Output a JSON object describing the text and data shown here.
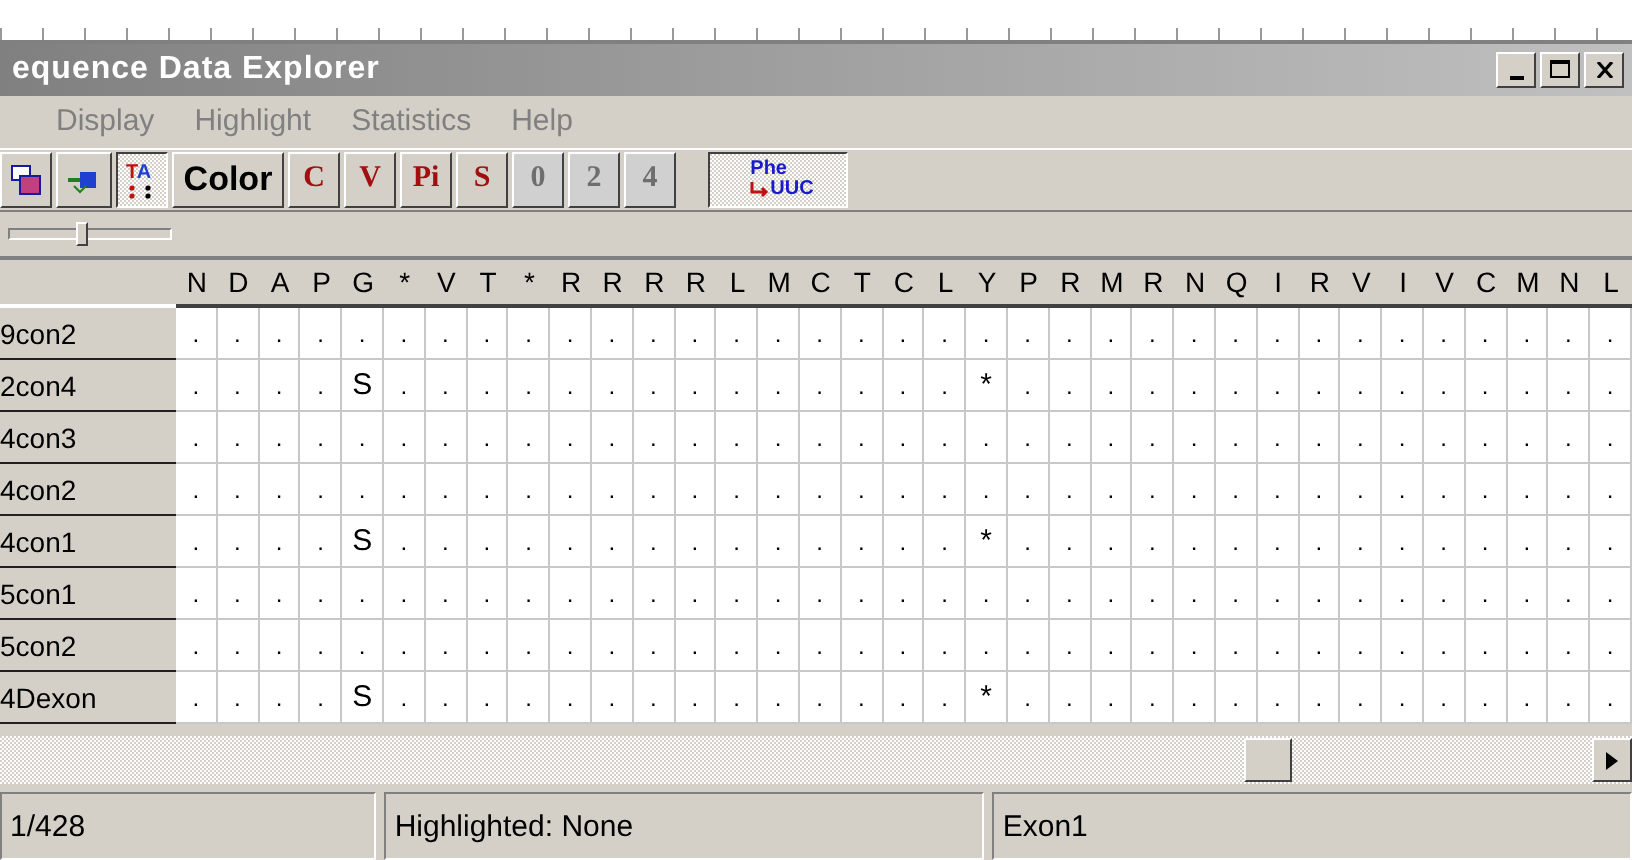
{
  "window": {
    "title": "equence Data Explorer"
  },
  "menu": [
    {
      "label": "Display"
    },
    {
      "label": "Highlight"
    },
    {
      "label": "Statistics"
    },
    {
      "label": "Help"
    }
  ],
  "toolbar": [
    {
      "kind": "icon",
      "pressed": false,
      "disabled": false
    },
    {
      "kind": "icon",
      "pressed": false,
      "disabled": false
    },
    {
      "kind": "letters",
      "label": "TA",
      "pressed": true,
      "disabled": false
    },
    {
      "kind": "text",
      "label": "Color",
      "pressed": false,
      "disabled": false
    },
    {
      "kind": "code",
      "label": "C",
      "pressed": false,
      "disabled": false
    },
    {
      "kind": "code",
      "label": "V",
      "pressed": false,
      "disabled": false
    },
    {
      "kind": "code",
      "label": "Pi",
      "pressed": false,
      "disabled": false
    },
    {
      "kind": "code",
      "label": "S",
      "pressed": false,
      "disabled": false
    },
    {
      "kind": "code",
      "label": "0",
      "pressed": false,
      "disabled": true
    },
    {
      "kind": "code",
      "label": "2",
      "pressed": false,
      "disabled": true
    },
    {
      "kind": "code",
      "label": "4",
      "pressed": false,
      "disabled": true
    },
    {
      "kind": "translate",
      "label": "Phe",
      "label2": "UUC",
      "pressed": true,
      "disabled": false
    }
  ],
  "slider": {
    "level": 0.45
  },
  "grid": {
    "columns": [
      "N",
      "D",
      "A",
      "P",
      "G",
      "*",
      "V",
      "T",
      "*",
      "R",
      "R",
      "R",
      "R",
      "L",
      "M",
      "C",
      "T",
      "C",
      "L",
      "Y",
      "P",
      "R",
      "M",
      "R",
      "N",
      "Q",
      "I",
      "R",
      "V",
      "I",
      "V",
      "C",
      "M",
      "N",
      "L"
    ],
    "rows": [
      {
        "name": "9con2",
        "cells": [
          ".",
          ".",
          ".",
          ".",
          ".",
          ".",
          ".",
          ".",
          ".",
          ".",
          ".",
          ".",
          ".",
          ".",
          ".",
          ".",
          ".",
          ".",
          ".",
          ".",
          ".",
          ".",
          ".",
          ".",
          ".",
          ".",
          ".",
          ".",
          ".",
          ".",
          ".",
          ".",
          ".",
          ".",
          "."
        ]
      },
      {
        "name": "2con4",
        "cells": [
          ".",
          ".",
          ".",
          ".",
          "S",
          ".",
          ".",
          ".",
          ".",
          ".",
          ".",
          ".",
          ".",
          ".",
          ".",
          ".",
          ".",
          ".",
          ".",
          "*",
          ".",
          ".",
          ".",
          ".",
          ".",
          ".",
          ".",
          ".",
          ".",
          ".",
          ".",
          ".",
          ".",
          ".",
          "."
        ]
      },
      {
        "name": "4con3",
        "cells": [
          ".",
          ".",
          ".",
          ".",
          ".",
          ".",
          ".",
          ".",
          ".",
          ".",
          ".",
          ".",
          ".",
          ".",
          ".",
          ".",
          ".",
          ".",
          ".",
          ".",
          ".",
          ".",
          ".",
          ".",
          ".",
          ".",
          ".",
          ".",
          ".",
          ".",
          ".",
          ".",
          ".",
          ".",
          "."
        ]
      },
      {
        "name": "4con2",
        "cells": [
          ".",
          ".",
          ".",
          ".",
          ".",
          ".",
          ".",
          ".",
          ".",
          ".",
          ".",
          ".",
          ".",
          ".",
          ".",
          ".",
          ".",
          ".",
          ".",
          ".",
          ".",
          ".",
          ".",
          ".",
          ".",
          ".",
          ".",
          ".",
          ".",
          ".",
          ".",
          ".",
          ".",
          ".",
          "."
        ]
      },
      {
        "name": "4con1",
        "cells": [
          ".",
          ".",
          ".",
          ".",
          "S",
          ".",
          ".",
          ".",
          ".",
          ".",
          ".",
          ".",
          ".",
          ".",
          ".",
          ".",
          ".",
          ".",
          ".",
          "*",
          ".",
          ".",
          ".",
          ".",
          ".",
          ".",
          ".",
          ".",
          ".",
          ".",
          ".",
          ".",
          ".",
          ".",
          "."
        ]
      },
      {
        "name": "5con1",
        "cells": [
          ".",
          ".",
          ".",
          ".",
          ".",
          ".",
          ".",
          ".",
          ".",
          ".",
          ".",
          ".",
          ".",
          ".",
          ".",
          ".",
          ".",
          ".",
          ".",
          ".",
          ".",
          ".",
          ".",
          ".",
          ".",
          ".",
          ".",
          ".",
          ".",
          ".",
          ".",
          ".",
          ".",
          ".",
          "."
        ]
      },
      {
        "name": "5con2",
        "cells": [
          ".",
          ".",
          ".",
          ".",
          ".",
          ".",
          ".",
          ".",
          ".",
          ".",
          ".",
          ".",
          ".",
          ".",
          ".",
          ".",
          ".",
          ".",
          ".",
          ".",
          ".",
          ".",
          ".",
          ".",
          ".",
          ".",
          ".",
          ".",
          ".",
          ".",
          ".",
          ".",
          ".",
          ".",
          "."
        ]
      },
      {
        "name": "4Dexon",
        "cells": [
          ".",
          ".",
          ".",
          ".",
          "S",
          ".",
          ".",
          ".",
          ".",
          ".",
          ".",
          ".",
          ".",
          ".",
          ".",
          ".",
          ".",
          ".",
          ".",
          "*",
          ".",
          ".",
          ".",
          ".",
          ".",
          ".",
          ".",
          ".",
          ".",
          ".",
          ".",
          ".",
          ".",
          ".",
          "."
        ]
      }
    ]
  },
  "status_bar": [
    {
      "text": "1/428"
    },
    {
      "text": "Highlighted: None"
    },
    {
      "text": "Exon1"
    }
  ]
}
